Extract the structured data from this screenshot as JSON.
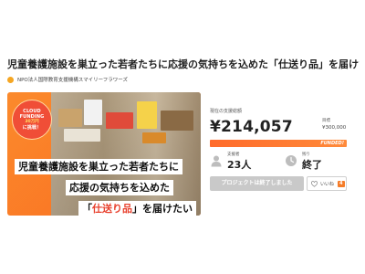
{
  "page": {
    "title": "児童養護施設を巣立った若者たちに応援の気持ちを込めた「仕送り品」を届けたい",
    "organization": "NPO法人国際教育支援機構スマイリーフラワーズ"
  },
  "hero": {
    "badge": {
      "line1": "CLOUD",
      "line2": "FUNDING",
      "line3": "30万円",
      "line4": "に挑戦！"
    },
    "caption": {
      "line1": "児童養護施設を巣立った若者たちに",
      "line2": "応援の気持ちを込めた",
      "line3_open": "「",
      "line3_highlight": "仕送り品",
      "line3_close": "」を届けたい"
    }
  },
  "funding": {
    "current_label": "現在の支援総額",
    "current_amount": "¥214,057",
    "goal_label": "目標",
    "goal_amount": "¥300,000",
    "progress_fraction": 1.0,
    "progress_text": "FUNDED!",
    "supporters_label": "支援者",
    "supporters_value": "23人",
    "remaining_label": "残り",
    "remaining_value": "終了",
    "ended_button_label": "プロジェクトは終了しました",
    "like_label": "いいね",
    "like_count": "4"
  },
  "colors": {
    "accent": "#f57c28",
    "progress": "#ff6b2b",
    "highlight": "#e8422f",
    "disabled": "#c9c9c9"
  },
  "icons": {
    "supporters": "person-icon",
    "remaining": "clock-icon",
    "like": "heart-icon"
  }
}
